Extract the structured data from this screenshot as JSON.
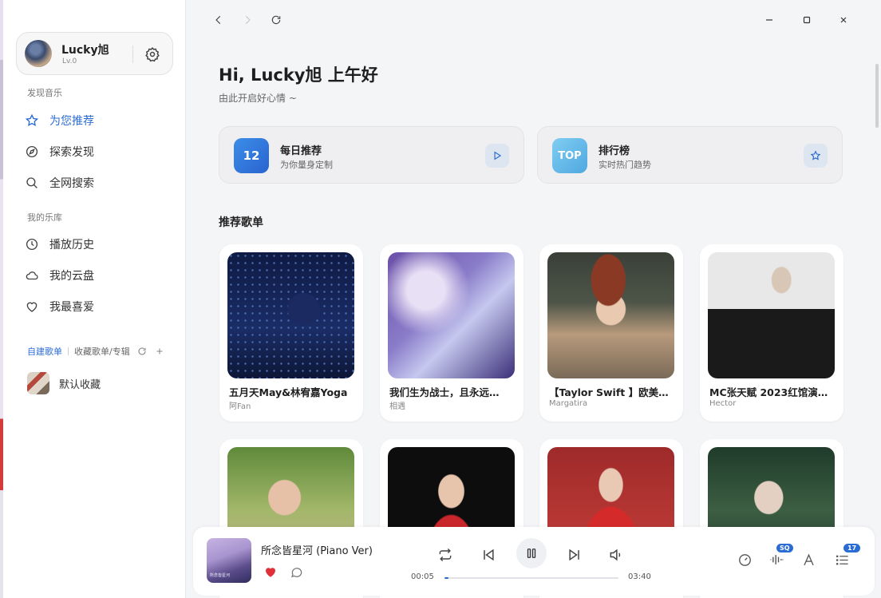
{
  "sidebar": {
    "user": {
      "name": "Lucky旭",
      "level": "Lv.0"
    },
    "section_discover": "发现音乐",
    "discover_items": [
      {
        "label": "为您推荐",
        "icon": "star-icon",
        "active": true
      },
      {
        "label": "探索发现",
        "icon": "compass-icon",
        "active": false
      },
      {
        "label": "全网搜索",
        "icon": "search-icon",
        "active": false
      }
    ],
    "section_library": "我的乐库",
    "library_items": [
      {
        "label": "播放历史",
        "icon": "clock-icon"
      },
      {
        "label": "我的云盘",
        "icon": "cloud-icon"
      },
      {
        "label": "我最喜爱",
        "icon": "heart-icon"
      }
    ],
    "playlist_tabs": {
      "created": "自建歌单",
      "collected": "收藏歌单/专辑"
    },
    "playlists": [
      {
        "label": "默认收藏"
      }
    ]
  },
  "main": {
    "greeting": "Hi, Lucky旭 上午好",
    "subgreeting": "由此开启好心情 ~",
    "features": [
      {
        "badge": "12",
        "title": "每日推荐",
        "subtitle": "为你量身定制",
        "action_icon": "play-icon"
      },
      {
        "badge": "TOP",
        "title": "排行榜",
        "subtitle": "实时热门趋势",
        "action_icon": "star-icon"
      }
    ],
    "recommend_title": "推荐歌单",
    "playlists": [
      {
        "title": "五月天May&林宥嘉Yoga",
        "author": "阿Fan"
      },
      {
        "title": "我们生为战士，且永远…",
        "author": "相遇"
      },
      {
        "title": "【Taylor Swift 】欧美…",
        "author": "Margatira"
      },
      {
        "title": "MC张天赋 2023红馆演…",
        "author": "Hector"
      },
      {
        "title": "",
        "author": ""
      },
      {
        "title": "",
        "author": ""
      },
      {
        "title": "",
        "author": ""
      },
      {
        "title": "",
        "author": ""
      }
    ]
  },
  "player": {
    "title": "所念皆星河 (Piano Ver)",
    "current_time": "00:05",
    "total_time": "03:40",
    "progress": 0.023,
    "quality_badge": "SQ",
    "queue_count": "17",
    "cover_text": "所念皆星河"
  },
  "colors": {
    "accent": "#2b6cd4",
    "heart": "#e0303a"
  }
}
